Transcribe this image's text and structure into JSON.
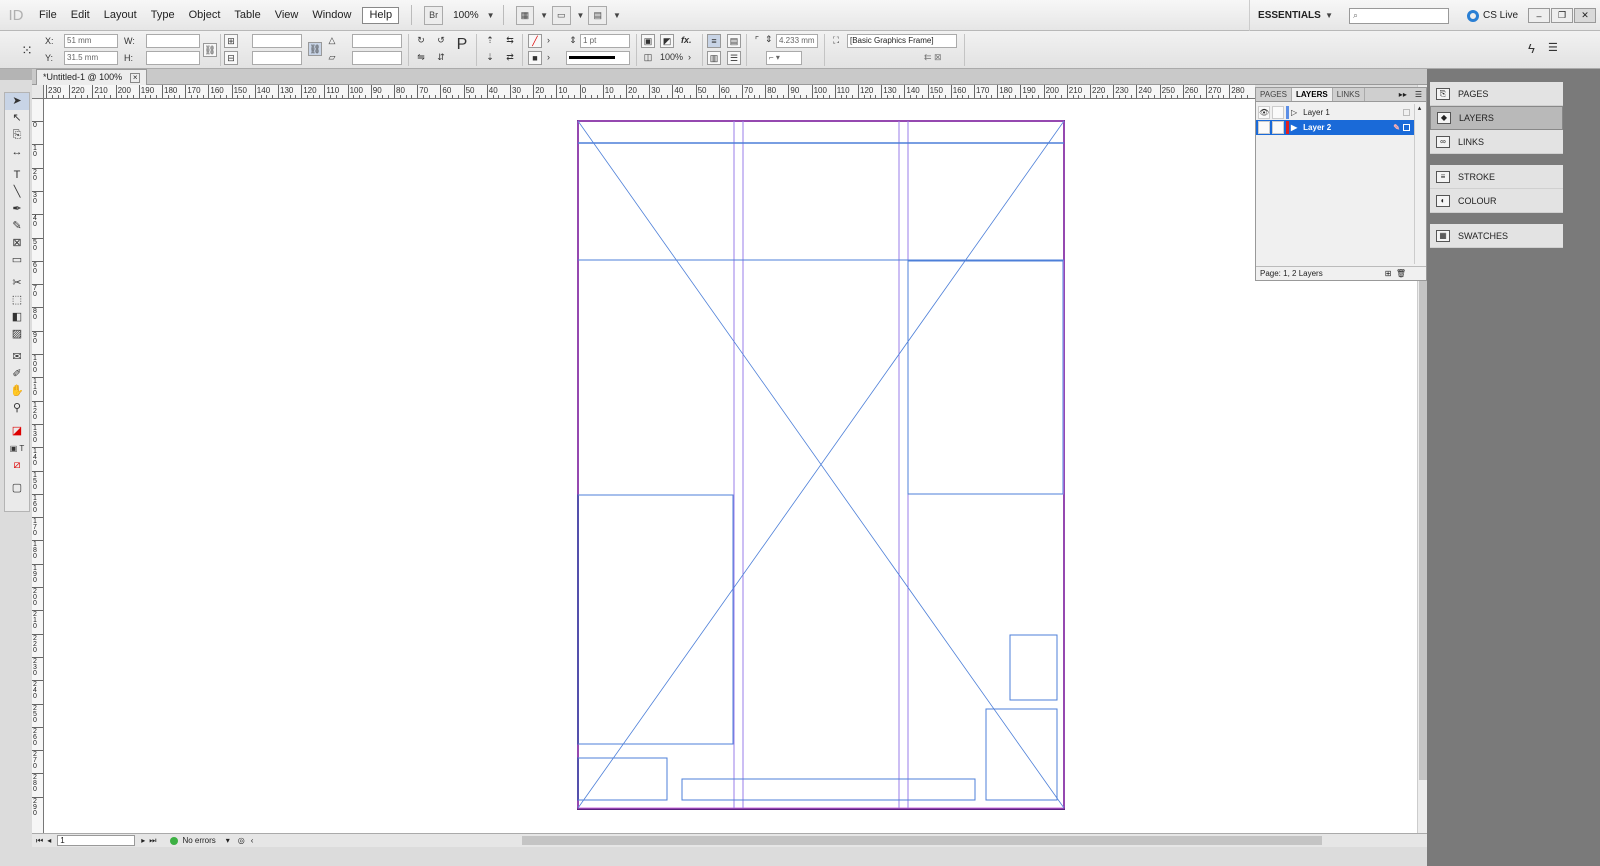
{
  "app": {
    "logo": "ID",
    "menus": [
      "File",
      "Edit",
      "Layout",
      "Type",
      "Object",
      "Table",
      "View",
      "Window",
      "Help"
    ],
    "bridge_label": "Br",
    "zoom": "100%",
    "workspace": "ESSENTIALS",
    "cs_live": "CS Live"
  },
  "control": {
    "x_label": "X:",
    "x_value": "51 mm",
    "y_label": "Y:",
    "y_value": "31.5 mm",
    "w_label": "W:",
    "h_label": "H:",
    "stroke_weight": "1 pt",
    "opacity": "100%",
    "fx_label": "fx.",
    "gutter": "4.233 mm",
    "object_style": "[Basic Graphics Frame]"
  },
  "document": {
    "tab_title": "*Untitled-1 @ 100%",
    "close_label": "×"
  },
  "ruler": {
    "h_labels": [
      "230",
      "220",
      "210",
      "200",
      "190",
      "180",
      "170",
      "160",
      "150",
      "140",
      "130",
      "120",
      "110",
      "100",
      "90",
      "80",
      "70",
      "60",
      "50",
      "40",
      "30",
      "20",
      "10",
      "0",
      "10",
      "20",
      "30",
      "40",
      "50",
      "60",
      "70",
      "80",
      "90",
      "100",
      "110",
      "120",
      "130",
      "140",
      "150",
      "160",
      "170",
      "180",
      "190",
      "200",
      "210",
      "220",
      "230",
      "240",
      "250",
      "260",
      "270",
      "280"
    ],
    "v_labels": [
      "0",
      "1 0",
      "2 0",
      "3 0",
      "4 0",
      "5 0",
      "6 0",
      "7 0",
      "8 0",
      "9 0",
      "1 0 0",
      "1 1 0",
      "1 2 0",
      "1 3 0",
      "1 4 0",
      "1 5 0",
      "1 6 0",
      "1 7 0",
      "1 8 0",
      "1 9 0",
      "2 0 0",
      "2 1 0",
      "2 2 0",
      "2 3 0",
      "2 4 0",
      "2 5 0",
      "2 6 0",
      "2 7 0",
      "2 8 0",
      "2 9 0"
    ]
  },
  "status": {
    "page": "1",
    "preflight": "No errors"
  },
  "layers_panel": {
    "tabs": [
      "PAGES",
      "LAYERS",
      "LINKS"
    ],
    "layers": [
      {
        "name": "Layer 1",
        "visible_icon": "eye-icon",
        "color": "#5b8ee6",
        "selected": false
      },
      {
        "name": "Layer 2",
        "visible_icon": "",
        "color": "#e02020",
        "selected": true
      }
    ],
    "footer": "Page: 1, 2 Layers"
  },
  "dock": {
    "items": [
      {
        "label": "PAGES",
        "icon": "pages-icon",
        "active": false
      },
      {
        "label": "LAYERS",
        "icon": "layers-icon",
        "active": true
      },
      {
        "label": "LINKS",
        "icon": "links-icon",
        "active": false
      },
      {
        "label": "STROKE",
        "icon": "stroke-icon",
        "active": false
      },
      {
        "label": "COLOUR",
        "icon": "colour-icon",
        "active": false
      },
      {
        "label": "SWATCHES",
        "icon": "swatches-icon",
        "active": false
      }
    ]
  },
  "colors": {
    "margin_guide": "#d070e0",
    "column_guide": "#9a7ee8",
    "frame_stroke": "#4d7fd8",
    "page_border": "#5a2080",
    "selection": "#1a6ad8"
  }
}
